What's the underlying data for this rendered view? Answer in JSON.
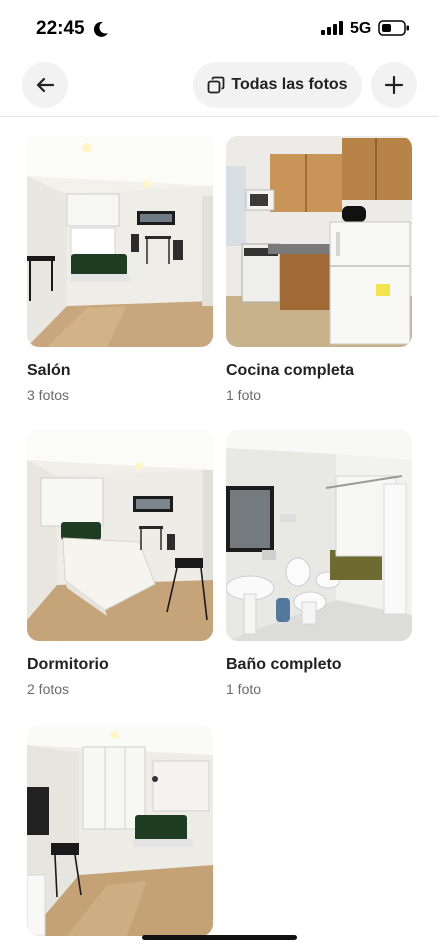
{
  "status_bar": {
    "time": "22:45",
    "network": "5G",
    "icons": [
      "moon-icon",
      "signal-icon",
      "battery-icon"
    ]
  },
  "top_bar": {
    "back_icon": "arrow-left-icon",
    "all_photos_label": "Todas las fotos",
    "all_photos_icon": "copy-icon",
    "add_icon": "plus-icon"
  },
  "categories": [
    {
      "title": "Salón",
      "count": "3 fotos",
      "photo": "living-room-photo"
    },
    {
      "title": "Cocina completa",
      "count": "1 foto",
      "photo": "kitchen-photo"
    },
    {
      "title": "Dormitorio",
      "count": "2 fotos",
      "photo": "bedroom-photo"
    },
    {
      "title": "Baño completo",
      "count": "1 foto",
      "photo": "bathroom-photo"
    },
    {
      "title": "",
      "count": "",
      "photo": "studio-photo"
    }
  ],
  "colors": {
    "accent_text": "#222222",
    "secondary_text": "#6a6a6a",
    "button_bg": "#f2f2f2",
    "sofa_green": "#1f3d22"
  }
}
